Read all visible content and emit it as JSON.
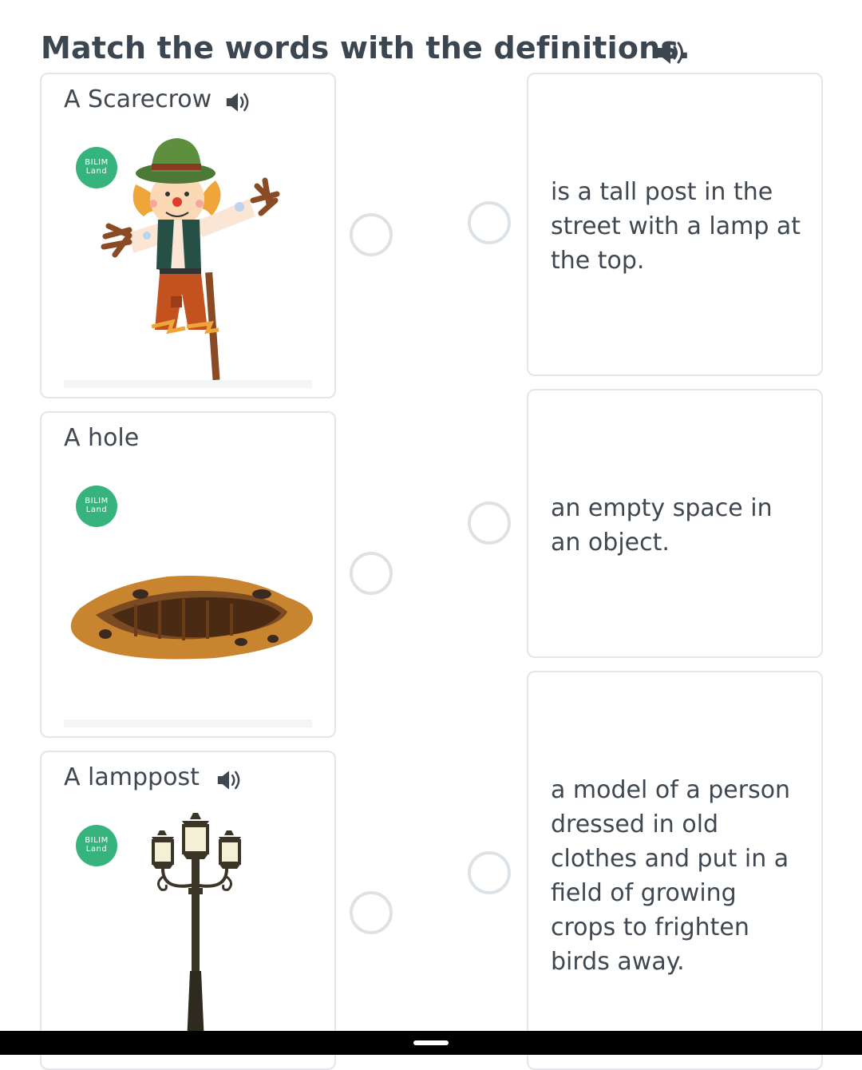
{
  "header": {
    "title": "Match the words with the definitions."
  },
  "words": [
    {
      "label": "A Scarecrow",
      "badge": [
        "BILIM",
        "Land"
      ],
      "image": "scarecrow-image"
    },
    {
      "label": "A hole",
      "badge": [
        "BILIM",
        "Land"
      ],
      "image": "hole-image"
    },
    {
      "label": "A lamppost",
      "badge": [
        "BILIM",
        "Land"
      ],
      "image": "lamppost-image"
    }
  ],
  "definitions": [
    {
      "text": "is a tall post in the street with a lamp at the top."
    },
    {
      "text": "an empty space in an object."
    },
    {
      "text": "a model of a person dressed in old clothes and put in a field of growing crops to frighten birds away."
    }
  ],
  "colors": {
    "accent": "#37b37e",
    "text": "#3f4750",
    "border": "#e3e6ea",
    "radio": "#dde2e6"
  },
  "icons": [
    "speaker-icon"
  ]
}
